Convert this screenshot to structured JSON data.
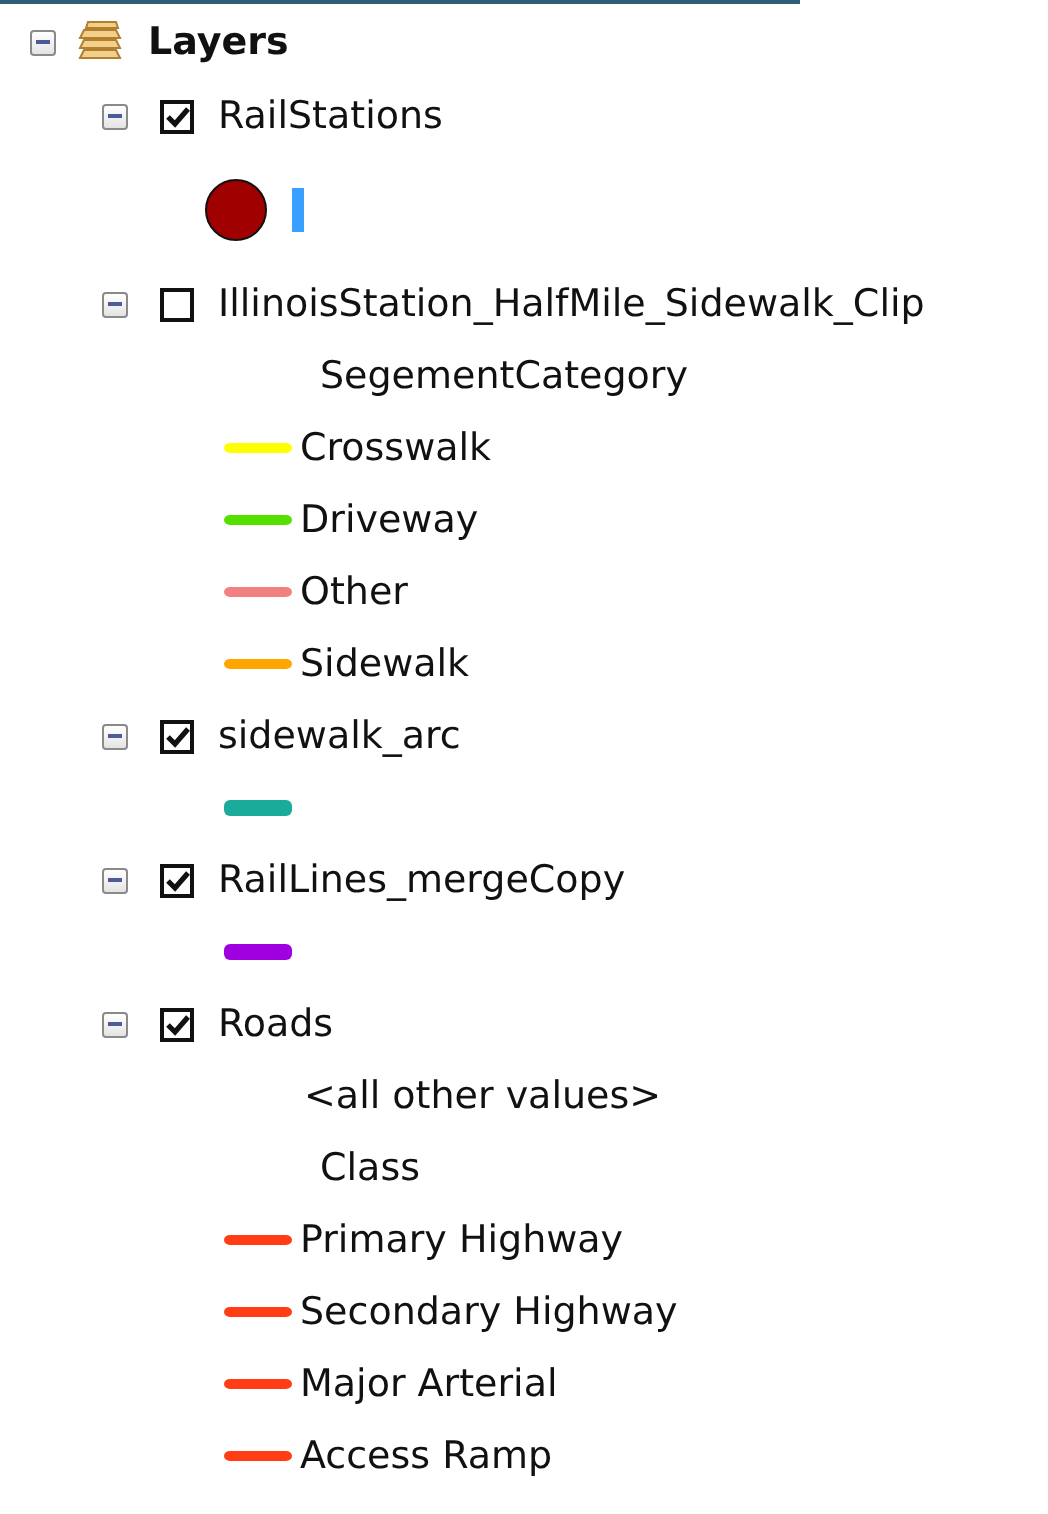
{
  "toc": {
    "title": "Layers",
    "expanded": true,
    "layers": [
      {
        "name": "RailStations",
        "checked": true,
        "expanded": true,
        "legend": [
          {
            "kind": "marker",
            "color": "#a00000"
          }
        ]
      },
      {
        "name": "IllinoisStation_HalfMile_Sidewalk_Clip",
        "checked": false,
        "expanded": true,
        "legend": [
          {
            "kind": "heading",
            "label": "SegementCategory"
          },
          {
            "kind": "line",
            "label": "Crosswalk",
            "color": "#ffff00"
          },
          {
            "kind": "line",
            "label": "Driveway",
            "color": "#55e000"
          },
          {
            "kind": "line",
            "label": "Other",
            "color": "#f28080"
          },
          {
            "kind": "line",
            "label": "Sidewalk",
            "color": "#ffa500"
          }
        ]
      },
      {
        "name": "sidewalk_arc",
        "checked": true,
        "expanded": true,
        "legend": [
          {
            "kind": "line",
            "color": "#1aab9b"
          }
        ]
      },
      {
        "name": "RailLines_mergeCopy",
        "checked": true,
        "expanded": true,
        "legend": [
          {
            "kind": "line",
            "color": "#a000e0"
          }
        ]
      },
      {
        "name": "Roads",
        "checked": true,
        "expanded": true,
        "legend": [
          {
            "kind": "other",
            "label": "<all other values>"
          },
          {
            "kind": "heading",
            "label": "Class"
          },
          {
            "kind": "line",
            "label": "Primary Highway",
            "color": "#ff3c14"
          },
          {
            "kind": "line",
            "label": "Secondary Highway",
            "color": "#ff3c14"
          },
          {
            "kind": "line",
            "label": "Major Arterial",
            "color": "#ff3c14"
          },
          {
            "kind": "line",
            "label": "Access Ramp",
            "color": "#ff3c14"
          }
        ]
      }
    ]
  }
}
